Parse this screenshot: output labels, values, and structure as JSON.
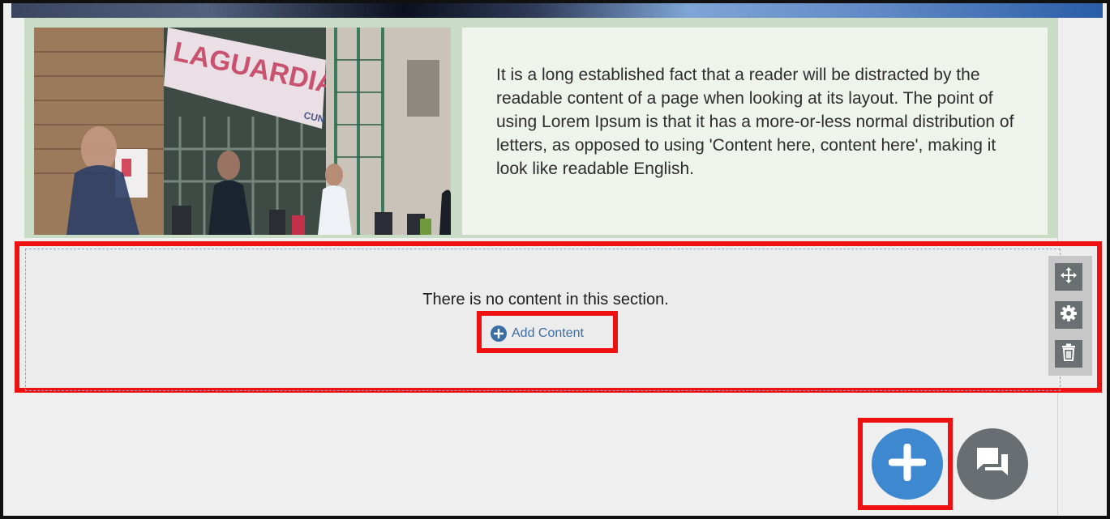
{
  "hero": {
    "paragraph": "It is a long established fact that a reader will be distracted by the  readable content of a page when looking at its layout. The point of  using Lorem Ipsum is that it has a more-or-less normal distribution of  letters, as opposed to using 'Content here, content here', making it  look like readable English.",
    "image_sign": "LAGUARDIA COMMUNITY COLLEGE",
    "image_sign_side": "CUNY"
  },
  "section": {
    "empty_message": "There is no content in this section.",
    "add_content_label": "Add Content"
  },
  "toolbar": {
    "icons": [
      "move-icon",
      "gear-icon",
      "trash-icon"
    ]
  },
  "fabs": {
    "add_icon": "plus-icon",
    "chat_icon": "chat-bubbles-icon"
  },
  "colors": {
    "highlight": "#ee1111",
    "link_blue": "#3a6ea5",
    "fab_blue": "#3d88cf",
    "fab_gray": "#696e72",
    "panel_green": "#c9dcc6"
  }
}
